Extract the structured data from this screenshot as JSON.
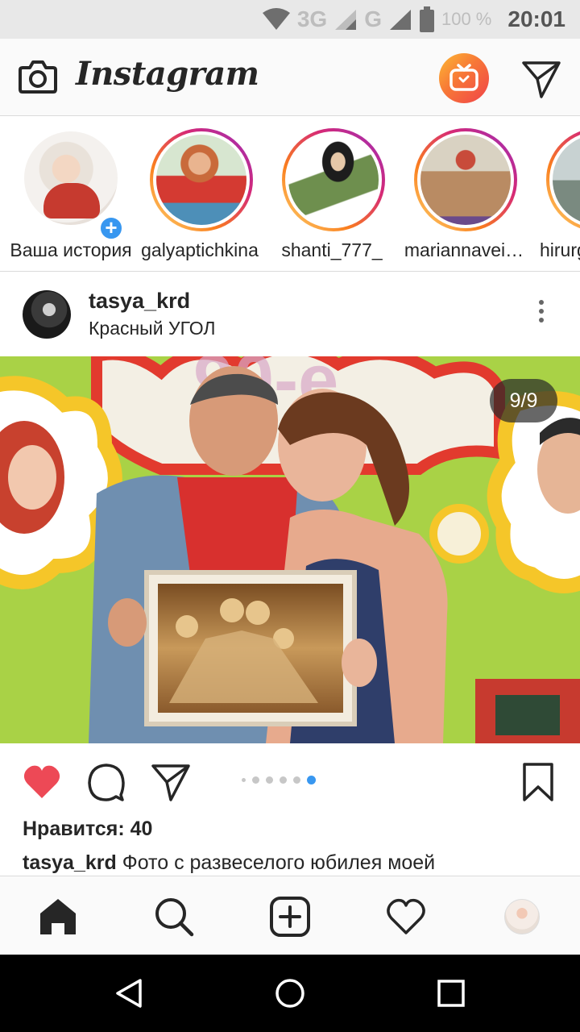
{
  "status_bar": {
    "network_1": "3G",
    "network_2": "G",
    "battery": "100 %",
    "time": "20:01"
  },
  "app": {
    "brand": "Instagram"
  },
  "stories": [
    {
      "label": "Ваша история",
      "own": true
    },
    {
      "label": "galyaptichkina"
    },
    {
      "label": "shanti_777_"
    },
    {
      "label": "mariannavei…"
    },
    {
      "label": "hirurg"
    }
  ],
  "post": {
    "username": "tasya_krd",
    "location": "Красный УГОЛ",
    "image_counter": "9/9",
    "carousel": {
      "count": 6,
      "active": 6
    },
    "likes": "Нравится: 40",
    "caption_user": "tasya_krd",
    "caption_text": " Фото с развеселого юбилея моей"
  },
  "colors": {
    "like_red": "#ed4956",
    "accent_blue": "#3897f0",
    "story_ring": "#d62976"
  }
}
